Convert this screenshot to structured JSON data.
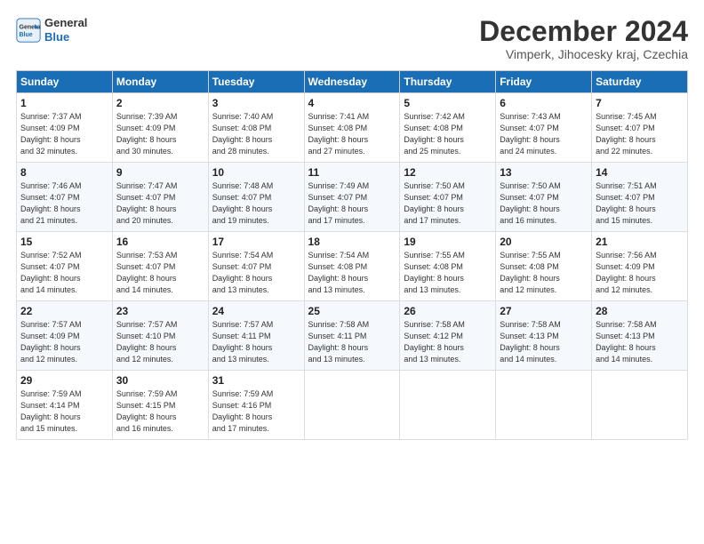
{
  "header": {
    "logo_line1": "General",
    "logo_line2": "Blue",
    "month_title": "December 2024",
    "subtitle": "Vimperk, Jihocesky kraj, Czechia"
  },
  "weekdays": [
    "Sunday",
    "Monday",
    "Tuesday",
    "Wednesday",
    "Thursday",
    "Friday",
    "Saturday"
  ],
  "weeks": [
    [
      {
        "day": "1",
        "info": "Sunrise: 7:37 AM\nSunset: 4:09 PM\nDaylight: 8 hours\nand 32 minutes."
      },
      {
        "day": "2",
        "info": "Sunrise: 7:39 AM\nSunset: 4:09 PM\nDaylight: 8 hours\nand 30 minutes."
      },
      {
        "day": "3",
        "info": "Sunrise: 7:40 AM\nSunset: 4:08 PM\nDaylight: 8 hours\nand 28 minutes."
      },
      {
        "day": "4",
        "info": "Sunrise: 7:41 AM\nSunset: 4:08 PM\nDaylight: 8 hours\nand 27 minutes."
      },
      {
        "day": "5",
        "info": "Sunrise: 7:42 AM\nSunset: 4:08 PM\nDaylight: 8 hours\nand 25 minutes."
      },
      {
        "day": "6",
        "info": "Sunrise: 7:43 AM\nSunset: 4:07 PM\nDaylight: 8 hours\nand 24 minutes."
      },
      {
        "day": "7",
        "info": "Sunrise: 7:45 AM\nSunset: 4:07 PM\nDaylight: 8 hours\nand 22 minutes."
      }
    ],
    [
      {
        "day": "8",
        "info": "Sunrise: 7:46 AM\nSunset: 4:07 PM\nDaylight: 8 hours\nand 21 minutes."
      },
      {
        "day": "9",
        "info": "Sunrise: 7:47 AM\nSunset: 4:07 PM\nDaylight: 8 hours\nand 20 minutes."
      },
      {
        "day": "10",
        "info": "Sunrise: 7:48 AM\nSunset: 4:07 PM\nDaylight: 8 hours\nand 19 minutes."
      },
      {
        "day": "11",
        "info": "Sunrise: 7:49 AM\nSunset: 4:07 PM\nDaylight: 8 hours\nand 17 minutes."
      },
      {
        "day": "12",
        "info": "Sunrise: 7:50 AM\nSunset: 4:07 PM\nDaylight: 8 hours\nand 17 minutes."
      },
      {
        "day": "13",
        "info": "Sunrise: 7:50 AM\nSunset: 4:07 PM\nDaylight: 8 hours\nand 16 minutes."
      },
      {
        "day": "14",
        "info": "Sunrise: 7:51 AM\nSunset: 4:07 PM\nDaylight: 8 hours\nand 15 minutes."
      }
    ],
    [
      {
        "day": "15",
        "info": "Sunrise: 7:52 AM\nSunset: 4:07 PM\nDaylight: 8 hours\nand 14 minutes."
      },
      {
        "day": "16",
        "info": "Sunrise: 7:53 AM\nSunset: 4:07 PM\nDaylight: 8 hours\nand 14 minutes."
      },
      {
        "day": "17",
        "info": "Sunrise: 7:54 AM\nSunset: 4:07 PM\nDaylight: 8 hours\nand 13 minutes."
      },
      {
        "day": "18",
        "info": "Sunrise: 7:54 AM\nSunset: 4:08 PM\nDaylight: 8 hours\nand 13 minutes."
      },
      {
        "day": "19",
        "info": "Sunrise: 7:55 AM\nSunset: 4:08 PM\nDaylight: 8 hours\nand 13 minutes."
      },
      {
        "day": "20",
        "info": "Sunrise: 7:55 AM\nSunset: 4:08 PM\nDaylight: 8 hours\nand 12 minutes."
      },
      {
        "day": "21",
        "info": "Sunrise: 7:56 AM\nSunset: 4:09 PM\nDaylight: 8 hours\nand 12 minutes."
      }
    ],
    [
      {
        "day": "22",
        "info": "Sunrise: 7:57 AM\nSunset: 4:09 PM\nDaylight: 8 hours\nand 12 minutes."
      },
      {
        "day": "23",
        "info": "Sunrise: 7:57 AM\nSunset: 4:10 PM\nDaylight: 8 hours\nand 12 minutes."
      },
      {
        "day": "24",
        "info": "Sunrise: 7:57 AM\nSunset: 4:11 PM\nDaylight: 8 hours\nand 13 minutes."
      },
      {
        "day": "25",
        "info": "Sunrise: 7:58 AM\nSunset: 4:11 PM\nDaylight: 8 hours\nand 13 minutes."
      },
      {
        "day": "26",
        "info": "Sunrise: 7:58 AM\nSunset: 4:12 PM\nDaylight: 8 hours\nand 13 minutes."
      },
      {
        "day": "27",
        "info": "Sunrise: 7:58 AM\nSunset: 4:13 PM\nDaylight: 8 hours\nand 14 minutes."
      },
      {
        "day": "28",
        "info": "Sunrise: 7:58 AM\nSunset: 4:13 PM\nDaylight: 8 hours\nand 14 minutes."
      }
    ],
    [
      {
        "day": "29",
        "info": "Sunrise: 7:59 AM\nSunset: 4:14 PM\nDaylight: 8 hours\nand 15 minutes."
      },
      {
        "day": "30",
        "info": "Sunrise: 7:59 AM\nSunset: 4:15 PM\nDaylight: 8 hours\nand 16 minutes."
      },
      {
        "day": "31",
        "info": "Sunrise: 7:59 AM\nSunset: 4:16 PM\nDaylight: 8 hours\nand 17 minutes."
      },
      {
        "day": "",
        "info": ""
      },
      {
        "day": "",
        "info": ""
      },
      {
        "day": "",
        "info": ""
      },
      {
        "day": "",
        "info": ""
      }
    ]
  ]
}
